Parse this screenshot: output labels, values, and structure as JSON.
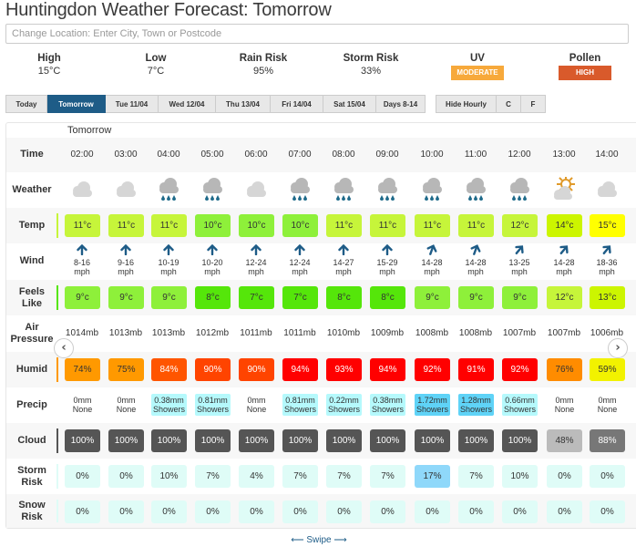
{
  "title": "Huntingdon Weather Forecast: Tomorrow",
  "location_placeholder": "Change Location: Enter City, Town or Postcode",
  "summary": {
    "high": {
      "label": "High",
      "value": "15°C"
    },
    "low": {
      "label": "Low",
      "value": "7°C"
    },
    "rain": {
      "label": "Rain Risk",
      "value": "95%"
    },
    "storm": {
      "label": "Storm Risk",
      "value": "33%"
    },
    "uv": {
      "label": "UV",
      "value": "MODERATE",
      "color": "#f7a93b"
    },
    "pollen": {
      "label": "Pollen",
      "value": "HIGH",
      "color": "#d95a2b"
    }
  },
  "tabs": [
    "Today",
    "Tomorrow",
    "Tue 11/04",
    "Wed 12/04",
    "Thu 13/04",
    "Fri 14/04",
    "Sat 15/04",
    "Days 8-14"
  ],
  "active_tab": 1,
  "tabs2": [
    "Hide Hourly",
    "C",
    "F"
  ],
  "day_label": "Tomorrow",
  "row_labels": {
    "time": "Time",
    "weather": "Weather",
    "temp": "Temp",
    "wind": "Wind",
    "feels": "Feels Like",
    "pressure": "Air Pressure",
    "humid": "Humid",
    "precip": "Precip",
    "cloud": "Cloud",
    "storm": "Storm Risk",
    "snow": "Snow Risk"
  },
  "hours": [
    {
      "time": "02:00",
      "weather": "cloud",
      "temp": "11°c",
      "temp_c": "#c6f53a",
      "wind_dir": 0,
      "wind": "8-16",
      "feels": "9°c",
      "feels_c": "#8ef03a",
      "pressure": "1014mb",
      "humid": "74%",
      "humid_c": "#ff9900",
      "precip": "0mm",
      "precip_t": "None",
      "precip_c": "",
      "cloud": "100%",
      "cloud_c": "#555555",
      "storm": "0%",
      "storm_c": "#dffcf7",
      "snow": "0%"
    },
    {
      "time": "03:00",
      "weather": "cloud",
      "temp": "11°c",
      "temp_c": "#c6f53a",
      "wind_dir": 0,
      "wind": "9-16",
      "feels": "9°c",
      "feels_c": "#8ef03a",
      "pressure": "1013mb",
      "humid": "75%",
      "humid_c": "#ff9900",
      "precip": "0mm",
      "precip_t": "None",
      "precip_c": "",
      "cloud": "100%",
      "cloud_c": "#555555",
      "storm": "0%",
      "storm_c": "#dffcf7",
      "snow": "0%"
    },
    {
      "time": "04:00",
      "weather": "rain",
      "temp": "11°c",
      "temp_c": "#c6f53a",
      "wind_dir": 0,
      "wind": "10-19",
      "feels": "9°c",
      "feels_c": "#8ef03a",
      "pressure": "1013mb",
      "humid": "84%",
      "humid_c": "#ff5500",
      "precip": "0.38mm",
      "precip_t": "Showers",
      "precip_c": "#b5f9fc",
      "cloud": "100%",
      "cloud_c": "#555555",
      "storm": "10%",
      "storm_c": "#dffcf7",
      "snow": "0%"
    },
    {
      "time": "05:00",
      "weather": "rain",
      "temp": "10°c",
      "temp_c": "#8ef03a",
      "wind_dir": 0,
      "wind": "10-20",
      "feels": "8°c",
      "feels_c": "#55e60a",
      "pressure": "1012mb",
      "humid": "90%",
      "humid_c": "#ff4400",
      "precip": "0.81mm",
      "precip_t": "Showers",
      "precip_c": "#b5f9fc",
      "cloud": "100%",
      "cloud_c": "#555555",
      "storm": "7%",
      "storm_c": "#dffcf7",
      "snow": "0%"
    },
    {
      "time": "06:00",
      "weather": "cloud",
      "temp": "10°c",
      "temp_c": "#8ef03a",
      "wind_dir": 0,
      "wind": "12-24",
      "feels": "7°c",
      "feels_c": "#55e60a",
      "pressure": "1011mb",
      "humid": "90%",
      "humid_c": "#ff4400",
      "precip": "0mm",
      "precip_t": "None",
      "precip_c": "",
      "cloud": "100%",
      "cloud_c": "#555555",
      "storm": "4%",
      "storm_c": "#dffcf7",
      "snow": "0%"
    },
    {
      "time": "07:00",
      "weather": "rain",
      "temp": "10°c",
      "temp_c": "#8ef03a",
      "wind_dir": 0,
      "wind": "12-24",
      "feels": "7°c",
      "feels_c": "#55e60a",
      "pressure": "1011mb",
      "humid": "94%",
      "humid_c": "#ff0000",
      "precip": "0.81mm",
      "precip_t": "Showers",
      "precip_c": "#b5f9fc",
      "cloud": "100%",
      "cloud_c": "#555555",
      "storm": "7%",
      "storm_c": "#dffcf7",
      "snow": "0%"
    },
    {
      "time": "08:00",
      "weather": "rain",
      "temp": "11°c",
      "temp_c": "#c6f53a",
      "wind_dir": 0,
      "wind": "14-27",
      "feels": "8°c",
      "feels_c": "#55e60a",
      "pressure": "1010mb",
      "humid": "93%",
      "humid_c": "#ff0000",
      "precip": "0.22mm",
      "precip_t": "Showers",
      "precip_c": "#b5f9fc",
      "cloud": "100%",
      "cloud_c": "#555555",
      "storm": "7%",
      "storm_c": "#dffcf7",
      "snow": "0%"
    },
    {
      "time": "09:00",
      "weather": "rain",
      "temp": "11°c",
      "temp_c": "#c6f53a",
      "wind_dir": 0,
      "wind": "15-29",
      "feels": "8°c",
      "feels_c": "#55e60a",
      "pressure": "1009mb",
      "humid": "94%",
      "humid_c": "#ff0000",
      "precip": "0.38mm",
      "precip_t": "Showers",
      "precip_c": "#b5f9fc",
      "cloud": "100%",
      "cloud_c": "#555555",
      "storm": "7%",
      "storm_c": "#dffcf7",
      "snow": "0%"
    },
    {
      "time": "10:00",
      "weather": "rain",
      "temp": "11°c",
      "temp_c": "#c6f53a",
      "wind_dir": 20,
      "wind": "14-28",
      "feels": "9°c",
      "feels_c": "#8ef03a",
      "pressure": "1008mb",
      "humid": "92%",
      "humid_c": "#ff0000",
      "precip": "1.72mm",
      "precip_t": "Showers",
      "precip_c": "#5fd3f7",
      "cloud": "100%",
      "cloud_c": "#555555",
      "storm": "17%",
      "storm_c": "#8fd8fa",
      "snow": "0%"
    },
    {
      "time": "11:00",
      "weather": "rain",
      "temp": "11°c",
      "temp_c": "#c6f53a",
      "wind_dir": 20,
      "wind": "14-28",
      "feels": "9°c",
      "feels_c": "#8ef03a",
      "pressure": "1008mb",
      "humid": "91%",
      "humid_c": "#ff0000",
      "precip": "1.28mm",
      "precip_t": "Showers",
      "precip_c": "#5fd3f7",
      "cloud": "100%",
      "cloud_c": "#555555",
      "storm": "7%",
      "storm_c": "#dffcf7",
      "snow": "0%"
    },
    {
      "time": "12:00",
      "weather": "rain",
      "temp": "12°c",
      "temp_c": "#c6f53a",
      "wind_dir": 40,
      "wind": "13-25",
      "feels": "9°c",
      "feels_c": "#8ef03a",
      "pressure": "1007mb",
      "humid": "92%",
      "humid_c": "#ff0000",
      "precip": "0.66mm",
      "precip_t": "Showers",
      "precip_c": "#b5f9fc",
      "cloud": "100%",
      "cloud_c": "#555555",
      "storm": "10%",
      "storm_c": "#dffcf7",
      "snow": "0%"
    },
    {
      "time": "13:00",
      "weather": "sun-cloud",
      "temp": "14°c",
      "temp_c": "#ccf500",
      "wind_dir": 40,
      "wind": "14-28",
      "feels": "12°c",
      "feels_c": "#c6f53a",
      "pressure": "1007mb",
      "humid": "76%",
      "humid_c": "#ff8c00",
      "precip": "0mm",
      "precip_t": "None",
      "precip_c": "",
      "cloud": "48%",
      "cloud_c": "#bbbbbb",
      "storm": "0%",
      "storm_c": "#dffcf7",
      "snow": "0%"
    },
    {
      "time": "14:00",
      "weather": "cloud",
      "temp": "15°c",
      "temp_c": "#ffff00",
      "wind_dir": 40,
      "wind": "18-36",
      "feels": "13°c",
      "feels_c": "#ccf500",
      "pressure": "1006mb",
      "humid": "59%",
      "humid_c": "#f2f200",
      "precip": "0mm",
      "precip_t": "None",
      "precip_c": "",
      "cloud": "88%",
      "cloud_c": "#777777",
      "storm": "0%",
      "storm_c": "#dffcf7",
      "snow": "0%"
    }
  ],
  "wind_unit": "mph",
  "swipe_label": "Swipe"
}
